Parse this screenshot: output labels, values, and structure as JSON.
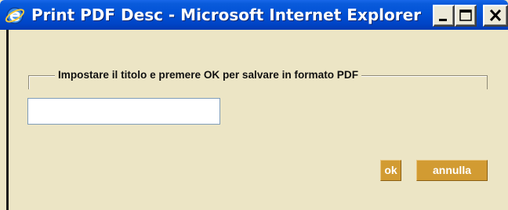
{
  "window": {
    "title": "Print PDF Desc - Microsoft Internet Explorer",
    "app_icon": "internet-explorer-icon",
    "controls": {
      "minimize_icon": "minimize-icon",
      "maximize_icon": "maximize-icon",
      "close_icon": "close-icon"
    }
  },
  "form": {
    "legend": "Impostare il titolo e premere OK per salvare in formato PDF",
    "title_input": {
      "value": "",
      "placeholder": ""
    },
    "ok_label": "ok",
    "cancel_label": "annulla"
  },
  "colors": {
    "window_background": "#ECE5C5",
    "titlebar_blue": "#0152D6",
    "button_gold": "#D29B32",
    "button_text": "#FFFFFF"
  }
}
